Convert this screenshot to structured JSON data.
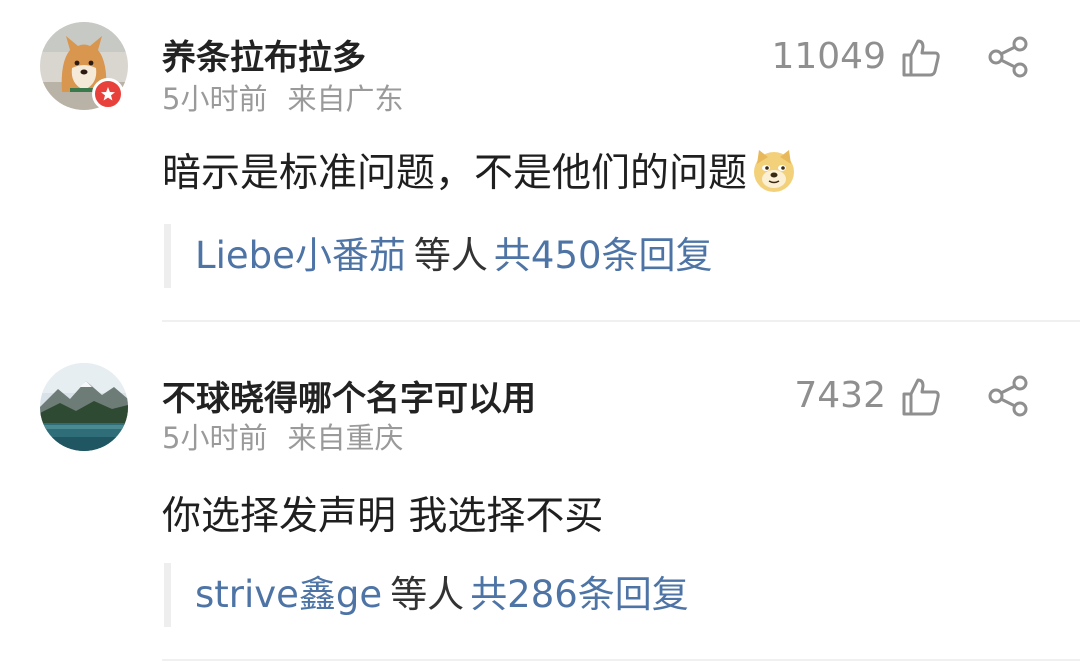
{
  "comments": [
    {
      "username": "养条拉布拉多",
      "time": "5小时前",
      "region": "来自广东",
      "likes": "11049",
      "text": "暗示是标准问题，不是他们的问题",
      "emoji": "doge-emoji",
      "avatar": "shiba-dog-avatar",
      "badge": "vip-star-badge",
      "reply_users": "Liebe小番茄",
      "reply_mid": "等人",
      "reply_total": "共450条回复"
    },
    {
      "username": "不球晓得哪个名字可以用",
      "time": "5小时前",
      "region": "来自重庆",
      "likes": "7432",
      "text": "你选择发声明 我选择不买",
      "avatar": "mountain-lake-avatar",
      "reply_users": "strive鑫ge",
      "reply_mid": "等人",
      "reply_total": "共286条回复"
    }
  ],
  "icons": {
    "like": "thumb-up-icon",
    "share": "share-icon"
  },
  "colors": {
    "link": "#4e74a6",
    "meta": "#9a9a9a",
    "badge": "#e8413c",
    "divider": "#f0f0f0"
  }
}
